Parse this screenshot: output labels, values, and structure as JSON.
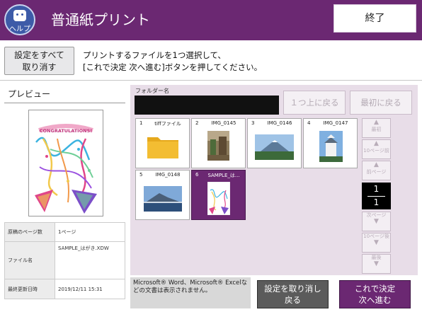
{
  "header": {
    "help_label": "ヘルプ",
    "title": "普通紙プリント",
    "end_label": "終了"
  },
  "toolbar": {
    "reset_label_1": "設定をすべて",
    "reset_label_2": "取り消す",
    "instruction_1": "プリントするファイルを1つ選択して、",
    "instruction_2": "[これで決定 次へ進む]ボタンを押してください。"
  },
  "preview": {
    "title": "プレビュー",
    "card_text": "CONGRATULATIONS!",
    "info": [
      {
        "label": "原稿のページ数",
        "value": "1ページ"
      },
      {
        "label": "ファイル名",
        "value": "SAMPLE_はがき.XDW"
      },
      {
        "label": "最終更新日時",
        "value": "2019/12/11 15:31"
      }
    ]
  },
  "folder": {
    "label": "フォルダー名",
    "value": "",
    "up_label": "１つ上に戻る",
    "first_label": "最初に戻る"
  },
  "files": [
    {
      "num": "1",
      "name": "tiffファイル",
      "kind": "folder-icon",
      "selected": false
    },
    {
      "num": "2",
      "name": "IMG_0145",
      "kind": "photo-thumbnail",
      "selected": false
    },
    {
      "num": "3",
      "name": "IMG_0146",
      "kind": "photo-thumbnail",
      "selected": false
    },
    {
      "num": "4",
      "name": "IMG_0147",
      "kind": "photo-thumbnail",
      "selected": false
    },
    {
      "num": "5",
      "name": "IMG_0148",
      "kind": "photo-thumbnail",
      "selected": false
    },
    {
      "num": "6",
      "name": "SAMPLE_は...",
      "kind": "card-thumbnail",
      "selected": true
    }
  ],
  "nav": {
    "first": "最初",
    "prev10": "10ページ前",
    "prev": "前ページ",
    "current_page": "1",
    "total_pages": "1",
    "next": "次ページ",
    "next10": "10ページ後",
    "last": "最後"
  },
  "footer": {
    "note": "Microsoft® Word、Microsoft® Excelなどの文書は表示されません。",
    "cancel_1": "設定を取り消し",
    "cancel_2": "戻る",
    "ok_1": "これで決定",
    "ok_2": "次へ進む"
  },
  "colors": {
    "brand": "#6b2872",
    "panel": "#e8dde8"
  }
}
